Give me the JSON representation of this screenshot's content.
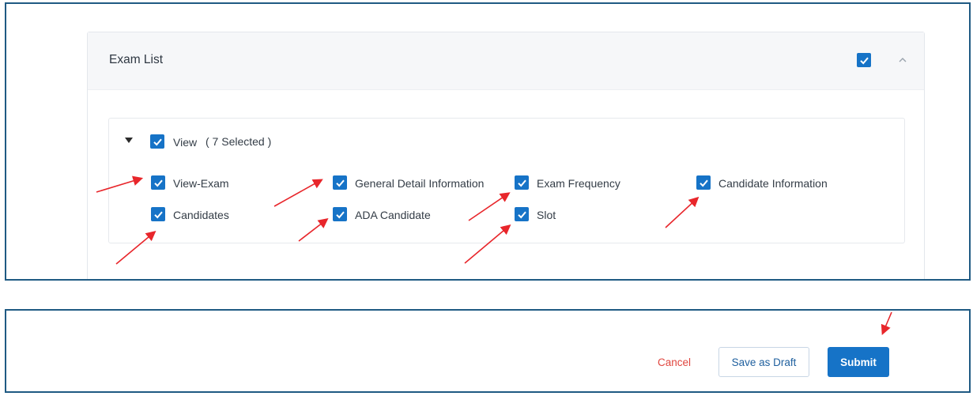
{
  "card": {
    "title": "Exam List",
    "header_checkbox": "checked",
    "collapse_icon": "chevron-up-icon"
  },
  "permissions": {
    "group_label": "View",
    "selected_count": "( 7 Selected )",
    "expand_icon": "caret-down-icon",
    "items": [
      {
        "label": "View-Exam",
        "checked": true
      },
      {
        "label": "General Detail Information",
        "checked": true
      },
      {
        "label": "Exam Frequency",
        "checked": true
      },
      {
        "label": "Candidate Information",
        "checked": true
      },
      {
        "label": "Candidates",
        "checked": true
      },
      {
        "label": "ADA Candidate",
        "checked": true
      },
      {
        "label": "Slot",
        "checked": true
      }
    ]
  },
  "footer": {
    "cancel_label": "Cancel",
    "draft_label": "Save as Draft",
    "submit_label": "Submit"
  },
  "colors": {
    "accent": "#1673c7",
    "cancel": "#e0463f",
    "frame_border": "#1f5a83",
    "annotation_arrow": "#e8262b"
  }
}
